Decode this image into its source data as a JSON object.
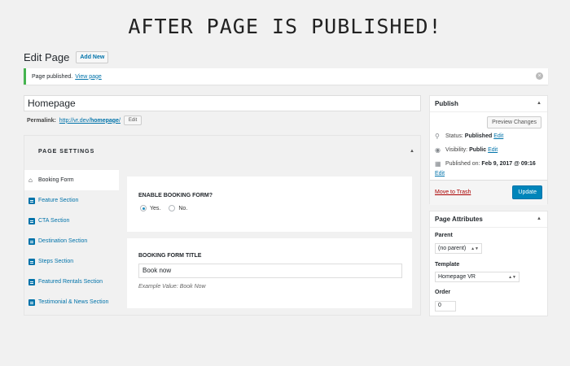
{
  "banner": "AFTER PAGE IS PUBLISHED!",
  "header": {
    "title": "Edit Page",
    "add_new": "Add New"
  },
  "notice": {
    "text": "Page published.",
    "link": "View page",
    "dismiss_icon": "dismiss-icon"
  },
  "title_value": "Homepage",
  "permalink": {
    "label": "Permalink:",
    "url_prefix": "http://vr.dev/",
    "url_slug": "homepage",
    "url_suffix": "/",
    "edit": "Edit"
  },
  "settings": {
    "title": "PAGE SETTINGS",
    "tabs": [
      {
        "label": "Booking Form",
        "icon": "home-icon"
      },
      {
        "label": "Feature Section",
        "icon": "document-icon"
      },
      {
        "label": "CTA Section",
        "icon": "document-icon"
      },
      {
        "label": "Destination Section",
        "icon": "document-icon"
      },
      {
        "label": "Steps Section",
        "icon": "document-icon"
      },
      {
        "label": "Featured Rentals Section",
        "icon": "document-icon"
      },
      {
        "label": "Testimonial & News Section",
        "icon": "document-icon"
      }
    ],
    "booking_enable": {
      "label": "ENABLE BOOKING FORM?",
      "options": [
        "Yes.",
        "No."
      ],
      "selected": "Yes."
    },
    "booking_title": {
      "label": "BOOKING FORM TITLE",
      "value": "Book now",
      "example": "Example Value: Book Now"
    }
  },
  "publish": {
    "title": "Publish",
    "preview": "Preview Changes",
    "status_label": "Status:",
    "status_value": "Published",
    "status_edit": "Edit",
    "visibility_label": "Visibility:",
    "visibility_value": "Public",
    "visibility_edit": "Edit",
    "published_label": "Published on:",
    "published_value": "Feb 9, 2017 @ 09:16",
    "published_edit": "Edit",
    "trash": "Move to Trash",
    "update": "Update"
  },
  "attributes": {
    "title": "Page Attributes",
    "parent_label": "Parent",
    "parent_value": "(no parent)",
    "template_label": "Template",
    "template_value": "Homepage VR",
    "order_label": "Order",
    "order_value": "0"
  },
  "colors": {
    "accent": "#0073aa",
    "success": "#46b450",
    "primary_button": "#0085ba",
    "trash": "#a00"
  }
}
